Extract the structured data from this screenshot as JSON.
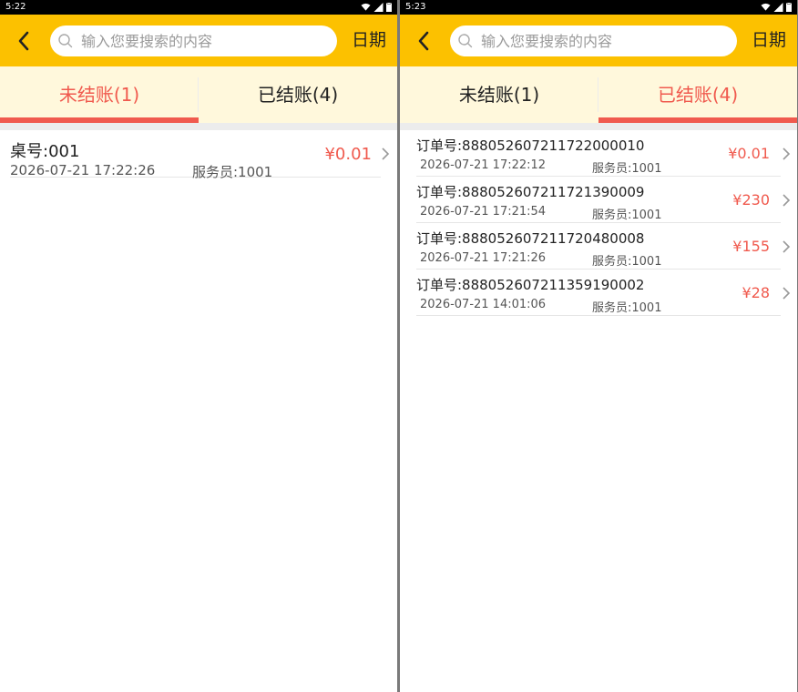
{
  "search": {
    "placeholder": "输入您要搜索的内容"
  },
  "toolbar": {
    "date_label": "日期"
  },
  "colors": {
    "toolbar_bg": "#fcc100",
    "accent": "#f05a4e",
    "tab_bg": "#fff8dc"
  },
  "left": {
    "status_time": "5:22",
    "tabs": [
      {
        "label": "未结账(1)",
        "active": true
      },
      {
        "label": "已结账(4)",
        "active": false
      }
    ],
    "rows": [
      {
        "title": "桌号:001",
        "datetime": "2026-07-21 17:22:26",
        "staff": "服务员:1001",
        "amount": "¥0.01"
      }
    ]
  },
  "right": {
    "status_time": "5:23",
    "tabs": [
      {
        "label": "未结账(1)",
        "active": false
      },
      {
        "label": "已结账(4)",
        "active": true
      }
    ],
    "rows": [
      {
        "title": "订单号:888052607211722000010",
        "datetime": "2026-07-21 17:22:12",
        "staff": "服务员:1001",
        "amount": "¥0.01"
      },
      {
        "title": "订单号:888052607211721390009",
        "datetime": "2026-07-21 17:21:54",
        "staff": "服务员:1001",
        "amount": "¥230"
      },
      {
        "title": "订单号:888052607211720480008",
        "datetime": "2026-07-21 17:21:26",
        "staff": "服务员:1001",
        "amount": "¥155"
      },
      {
        "title": "订单号:888052607211359190002",
        "datetime": "2026-07-21 14:01:06",
        "staff": "服务员:1001",
        "amount": "¥28"
      }
    ]
  }
}
